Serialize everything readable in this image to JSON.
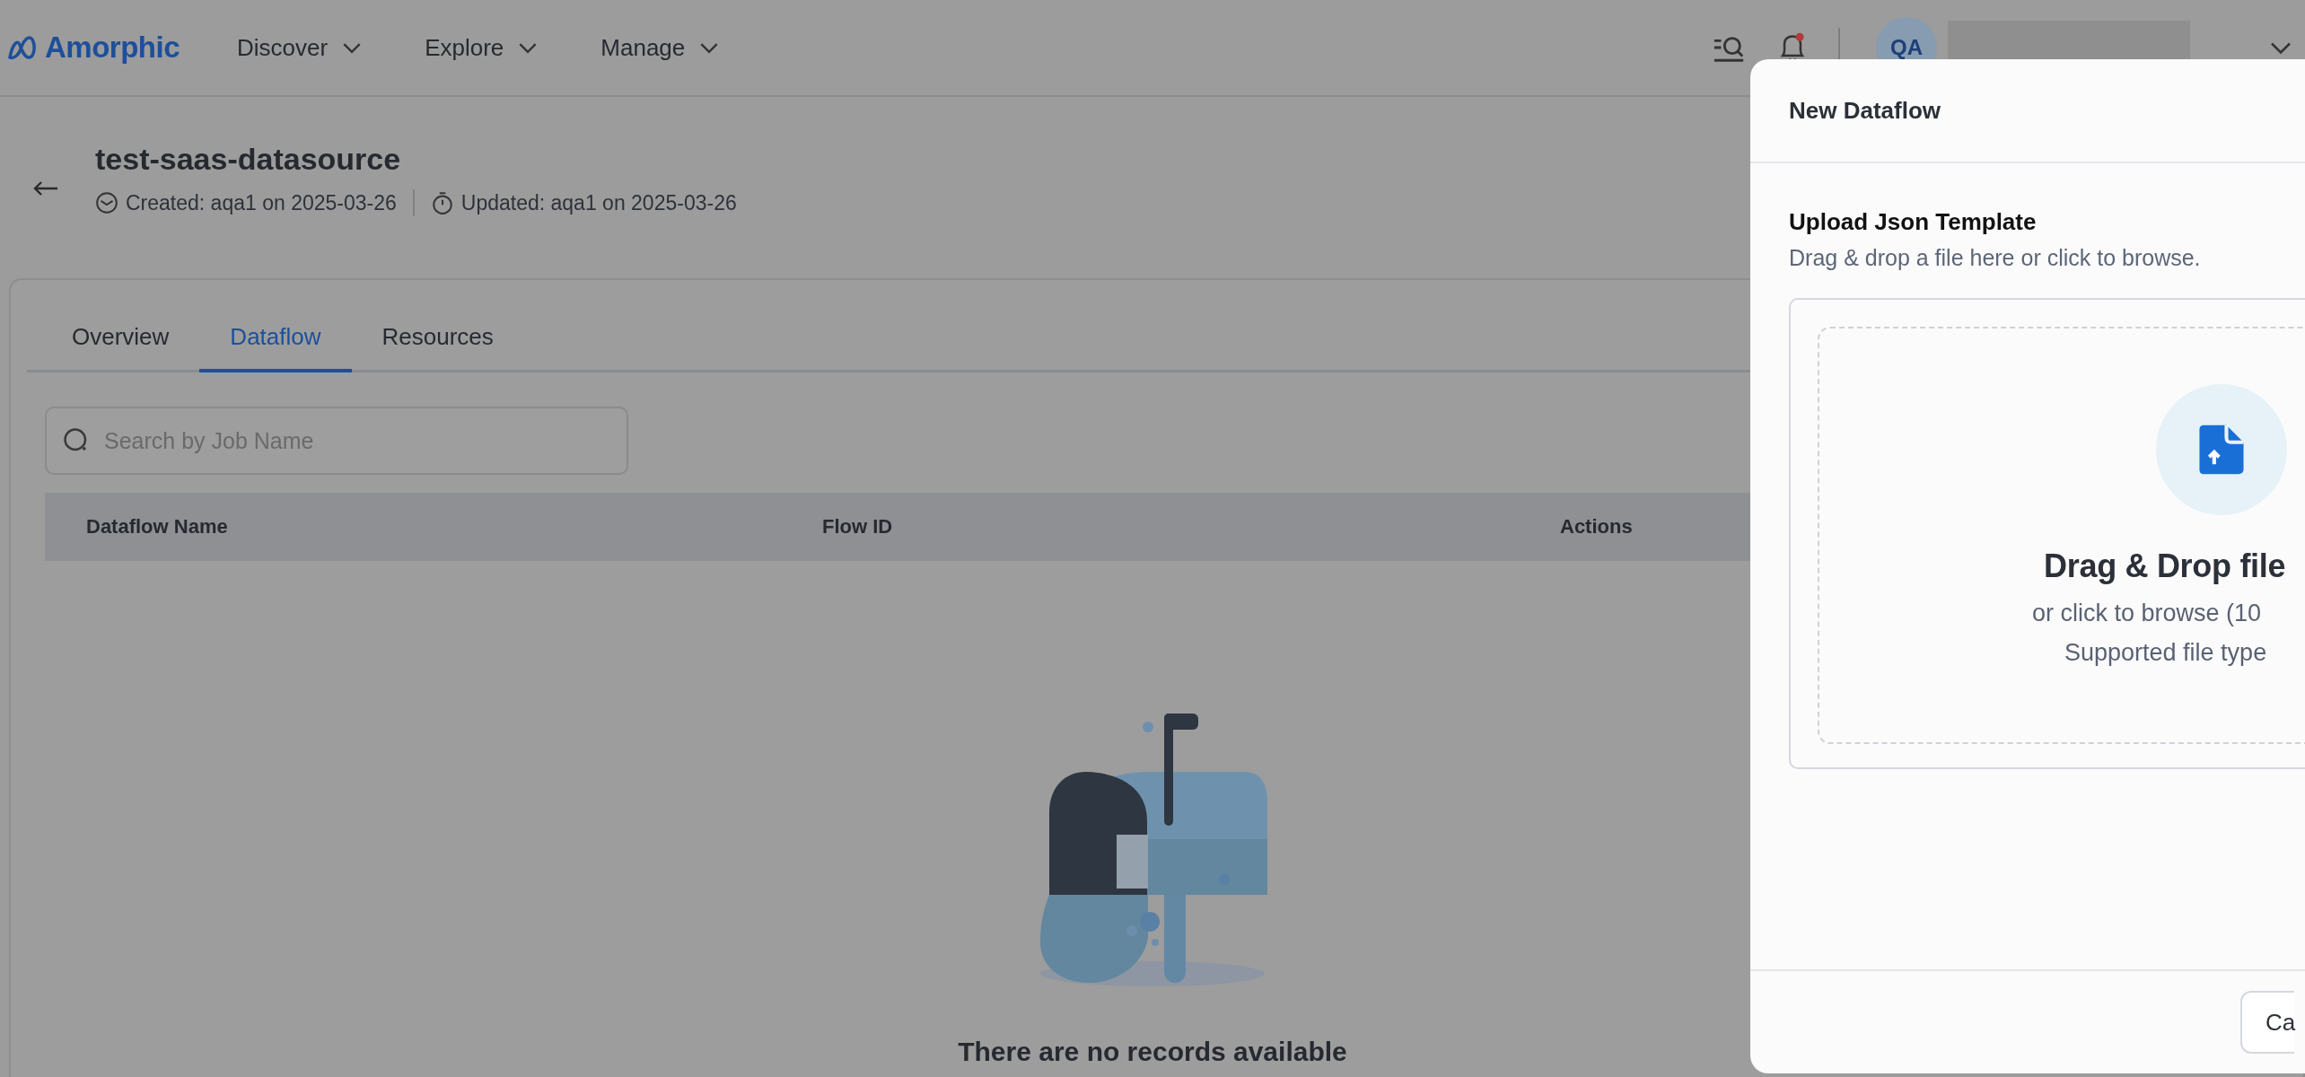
{
  "header": {
    "logo": "Amorphic",
    "nav": [
      {
        "label": "Discover",
        "expanded": false
      },
      {
        "label": "Explore",
        "expanded": false
      },
      {
        "label": "Manage",
        "expanded": false
      }
    ],
    "notifications": {
      "unread": true
    },
    "avatar": {
      "initials": "QA"
    }
  },
  "page": {
    "title": "test-saas-datasource",
    "created": "Created: aqa1 on 2025-03-26",
    "updated": "Updated: aqa1 on 2025-03-26"
  },
  "tabs": [
    {
      "label": "Overview",
      "selected": false
    },
    {
      "label": "Dataflow",
      "selected": true
    },
    {
      "label": "Resources",
      "selected": false
    }
  ],
  "search": {
    "placeholder": "Search by Job Name"
  },
  "table": {
    "columns": [
      "Dataflow Name",
      "Flow ID",
      "Actions"
    ],
    "empty_message": "There are no records available"
  },
  "drawer": {
    "title": "New Dataflow",
    "section_title": "Upload Json Template",
    "section_hint": "Drag & drop a file here or click to browse.",
    "dropzone": {
      "heading": "Drag & Drop file",
      "line_1": "or click to browse (10",
      "line_2": "Supported file type"
    },
    "buttons": [
      "Ca"
    ]
  }
}
